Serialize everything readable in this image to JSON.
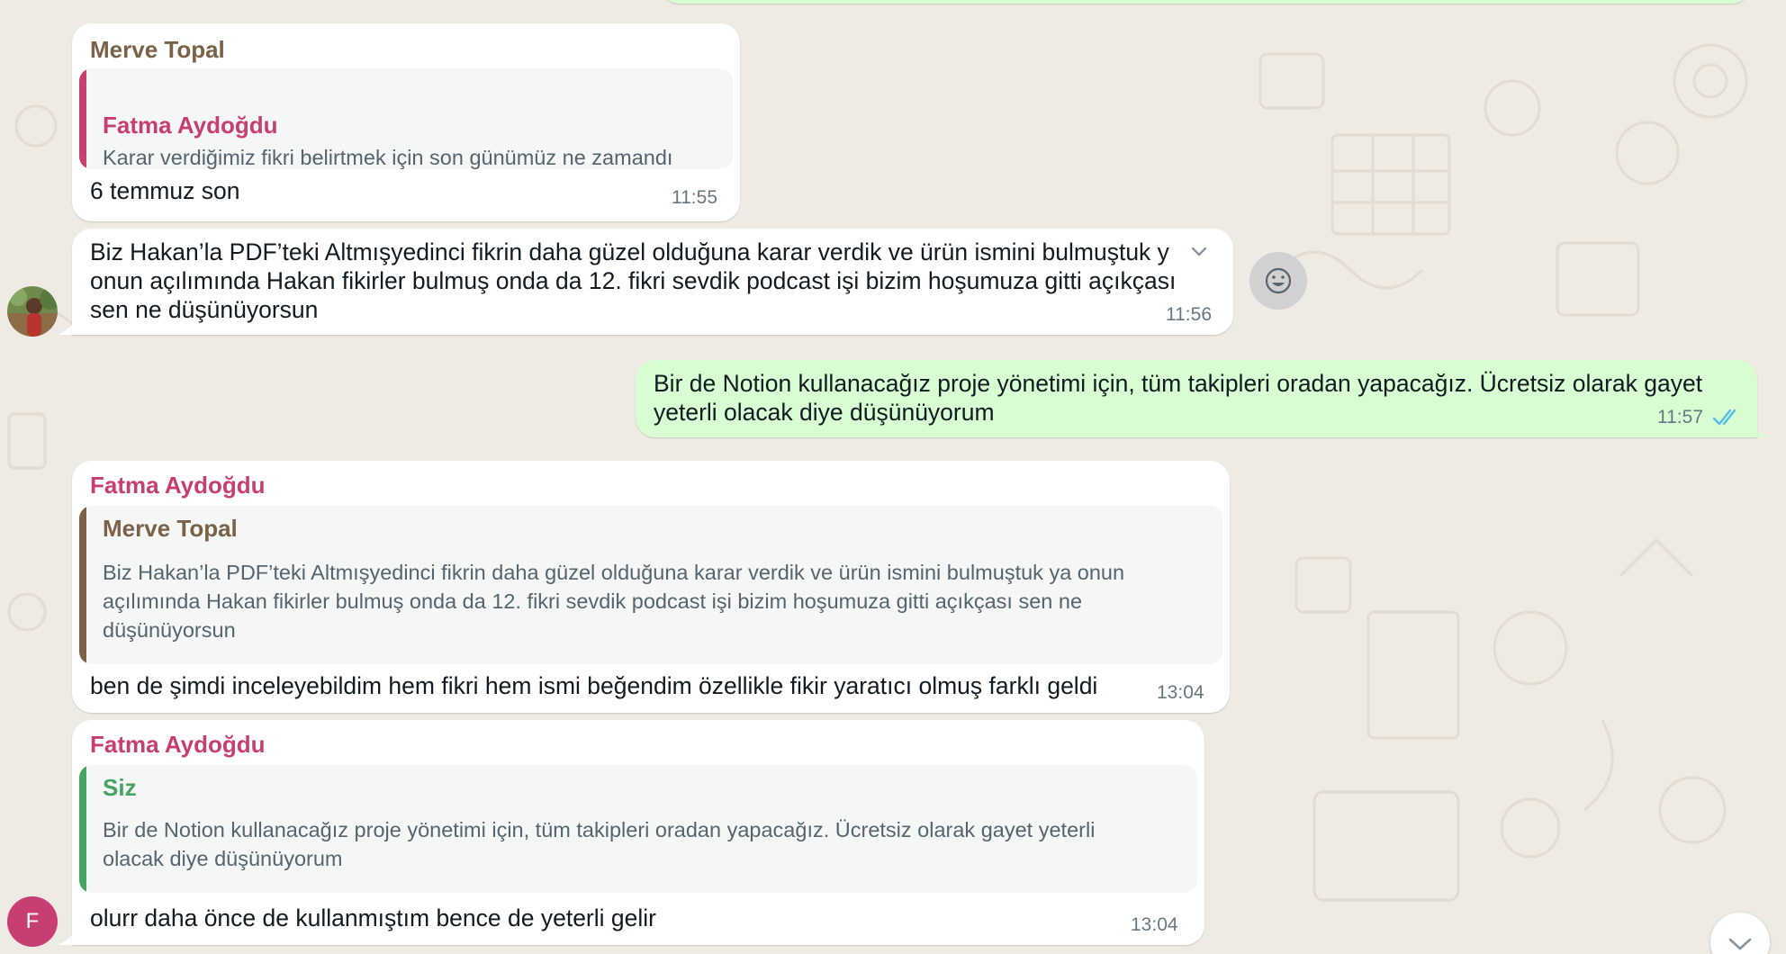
{
  "colors": {
    "chat_background": "#efeae2",
    "incoming_bubble": "#ffffff",
    "outgoing_bubble": "#d9fdd3",
    "merve_topal": "#7a6147",
    "fatma_aydogdu": "#c73f72",
    "siz": "#45a461",
    "read_ticks": "#53bdeb",
    "timestamp": "#667781"
  },
  "messages": [
    {
      "sender": "Merve Topal",
      "quote": {
        "name": "Fatma Aydoğdu",
        "text": "Karar verdiğimiz fikri belirtmek için son günümüz ne zamandı"
      },
      "text": "6 temmuz son",
      "time": "11:55"
    },
    {
      "line1": "Biz Hakan’la PDF’teki Altmışyedinci fikrin daha güzel olduğuna karar verdik ve ürün ismini bulmuştuk y",
      "line2": "onun açılımında Hakan fikirler bulmuş onda da 12. fikri sevdik podcast işi bizim hoşumuza gitti açıkçası",
      "line3": "sen ne düşünüyorsun",
      "time": "11:56",
      "menu_icon": "chevron-down-icon",
      "react_icon": "smiley-icon"
    },
    {
      "line1": "Bir de Notion kullanacağız proje yönetimi için, tüm takipleri oradan yapacağız. Ücretsiz olarak gayet",
      "line2": "yeterli olacak diye düşünüyorum",
      "time": "11:57",
      "status_icon": "double-check-icon"
    },
    {
      "sender": "Fatma Aydoğdu",
      "quote": {
        "name": "Merve Topal",
        "line1": "Biz Hakan’la PDF’teki Altmışyedinci fikrin daha güzel olduğuna karar verdik ve ürün ismini bulmuştuk ya onun",
        "line2": "açılımında Hakan fikirler bulmuş onda da 12. fikri sevdik podcast işi bizim hoşumuza gitti açıkçası sen ne",
        "line3": "düşünüyorsun"
      },
      "text": "ben de şimdi inceleyebildim hem fikri hem ismi beğendim özellikle fikir yaratıcı olmuş farklı geldi",
      "time": "13:04"
    },
    {
      "sender": "Fatma Aydoğdu",
      "quote": {
        "name": "Siz",
        "line1": "Bir de Notion kullanacağız proje yönetimi için, tüm takipleri oradan yapacağız. Ücretsiz olarak gayet yeterli",
        "line2": "olacak diye düşünüyorum"
      },
      "text": "olurr daha önce de kullanmıştım bence de yeterli gelir",
      "time": "13:04"
    }
  ],
  "avatar_fatma": {
    "initial": "F"
  },
  "scroll_button": {
    "icon": "chevron-down-icon"
  }
}
